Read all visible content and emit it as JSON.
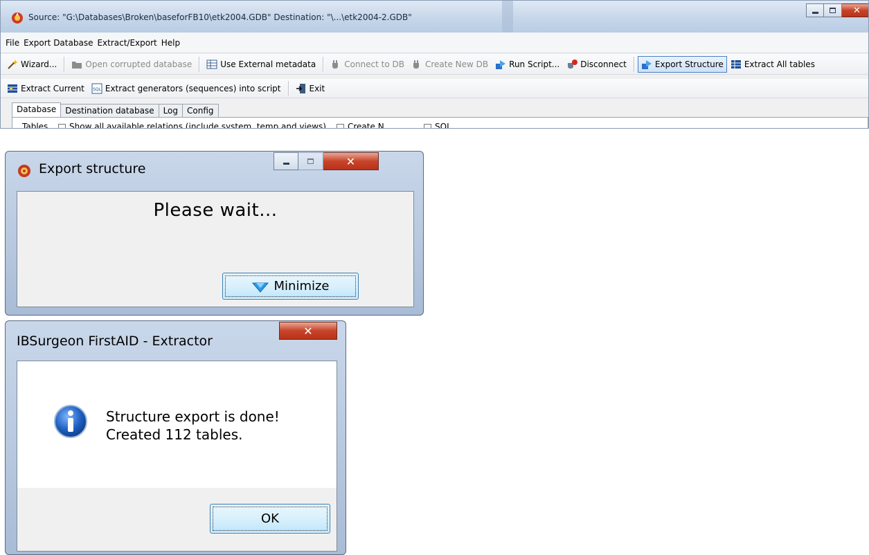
{
  "main_window": {
    "title": "Source: \"G:\\Databases\\Broken\\baseforFB10\\etk2004.GDB\" Destination: \"\\...\\etk2004-2.GDB\"",
    "menu": [
      "File",
      "Export Database",
      "Extract/Export",
      "Help"
    ],
    "toolbar1": {
      "wizard": "Wizard...",
      "open_corrupted": "Open corrupted database",
      "use_external_metadata": "Use External metadata",
      "connect_to_db": "Connect to DB",
      "create_new_db": "Create New DB",
      "run_script": "Run Script...",
      "disconnect": "Disconnect",
      "export_structure": "Export Structure",
      "extract_all_tables": "Extract All tables"
    },
    "toolbar2": {
      "extract_current": "Extract Current",
      "extract_generators": "Extract generators (sequences) into script",
      "exit": "Exit"
    },
    "tabs": [
      "Database",
      "Destination database",
      "Log",
      "Config"
    ],
    "active_tab": "Database",
    "cut_row": {
      "label": "Tables",
      "show_all_relations": "Show all available relations (include system, temp and views)",
      "create_n": "Create N",
      "sql": "SQL"
    }
  },
  "export_dialog": {
    "title": "Export structure",
    "message": "Please wait...",
    "minimize_button": "Minimize"
  },
  "message_dialog": {
    "title": "IBSurgeon FirstAID - Extractor",
    "line1": "Structure export is done!",
    "line2": "Created 112 tables.",
    "ok_button": "OK"
  },
  "colors": {
    "titlebar": "#c6d6ea",
    "close_button": "#c7432a",
    "button_accent": "#3c7fb1",
    "info_icon": "#1f5fbf"
  }
}
